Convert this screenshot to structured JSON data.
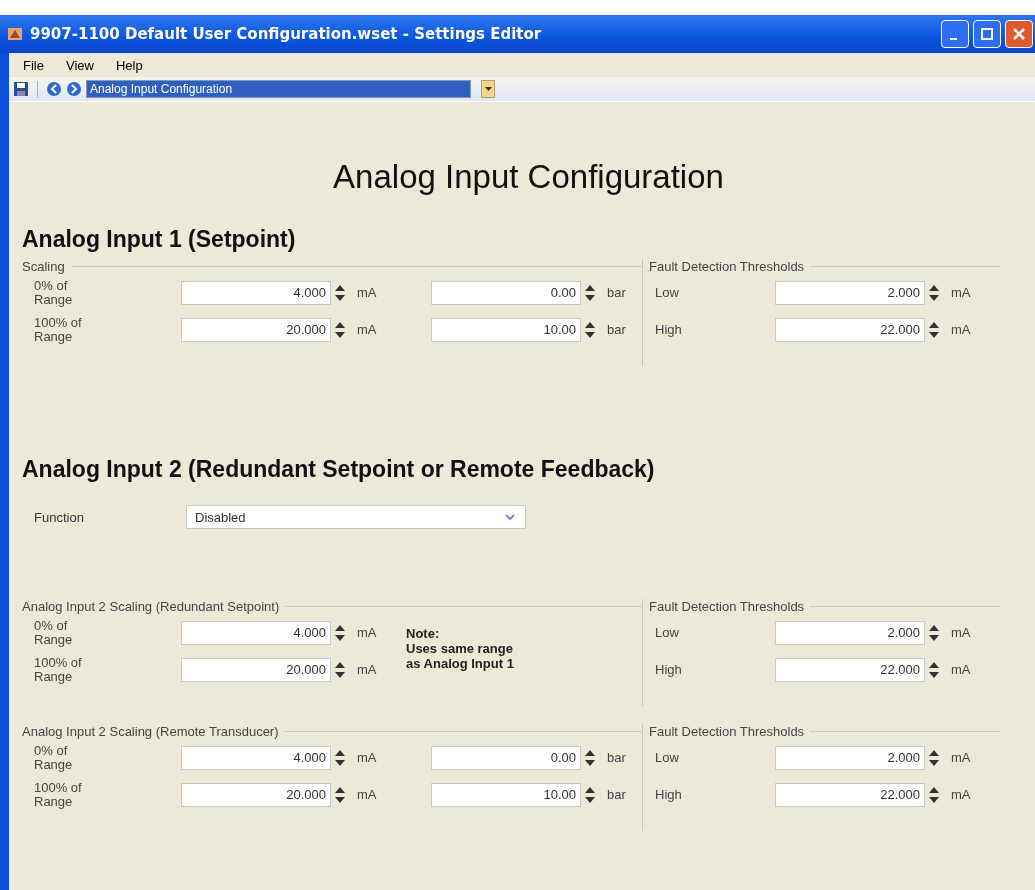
{
  "window": {
    "title": "9907-1100 Default User Configuration.wset - Settings Editor"
  },
  "menu": [
    "File",
    "View",
    "Help"
  ],
  "toolbar": {
    "page_select": {
      "value": "Analog Input Configuration"
    }
  },
  "page_title": "Analog Input Configuration",
  "sections": [
    {
      "title": "Analog Input 1 (Setpoint)",
      "blocks": [
        {
          "legend": "Scaling",
          "rows": [
            {
              "label": "0% of Range",
              "fields": [
                {
                  "value": "4.000",
                  "unit": "mA"
                },
                {
                  "value": "0.00",
                  "unit": "bar"
                }
              ]
            },
            {
              "label": "100% of Range",
              "fields": [
                {
                  "value": "20.000",
                  "unit": "mA"
                },
                {
                  "value": "10.00",
                  "unit": "bar"
                }
              ]
            }
          ],
          "thresholds": {
            "legend": "Fault Detection Thresholds",
            "rows": [
              {
                "label": "Low",
                "value": "2.000",
                "unit": "mA"
              },
              {
                "label": "High",
                "value": "22.000",
                "unit": "mA"
              }
            ]
          }
        }
      ]
    },
    {
      "title": "Analog Input 2 (Redundant Setpoint or Remote Feedback)",
      "function": {
        "label": "Function",
        "value": "Disabled"
      },
      "blocks": [
        {
          "legend": "Analog Input 2 Scaling (Redundant Setpoint)",
          "rows": [
            {
              "label": "0% of Range",
              "fields": [
                {
                  "value": "4.000",
                  "unit": "mA"
                }
              ]
            },
            {
              "label": "100% of Range",
              "fields": [
                {
                  "value": "20.000",
                  "unit": "mA"
                }
              ]
            }
          ],
          "note": "Note:\nUses same range\nas Analog Input 1",
          "thresholds": {
            "legend": "Fault Detection Thresholds",
            "rows": [
              {
                "label": "Low",
                "value": "2.000",
                "unit": "mA"
              },
              {
                "label": "High",
                "value": "22.000",
                "unit": "mA"
              }
            ]
          }
        },
        {
          "legend": "Analog Input 2 Scaling (Remote Transducer)",
          "rows": [
            {
              "label": "0% of Range",
              "fields": [
                {
                  "value": "4.000",
                  "unit": "mA"
                },
                {
                  "value": "0.00",
                  "unit": "bar"
                }
              ]
            },
            {
              "label": "100% of Range",
              "fields": [
                {
                  "value": "20.000",
                  "unit": "mA"
                },
                {
                  "value": "10.00",
                  "unit": "bar"
                }
              ]
            }
          ],
          "thresholds": {
            "legend": "Fault Detection Thresholds",
            "rows": [
              {
                "label": "Low",
                "value": "2.000",
                "unit": "mA"
              },
              {
                "label": "High",
                "value": "22.000",
                "unit": "mA"
              }
            ]
          }
        }
      ]
    }
  ]
}
